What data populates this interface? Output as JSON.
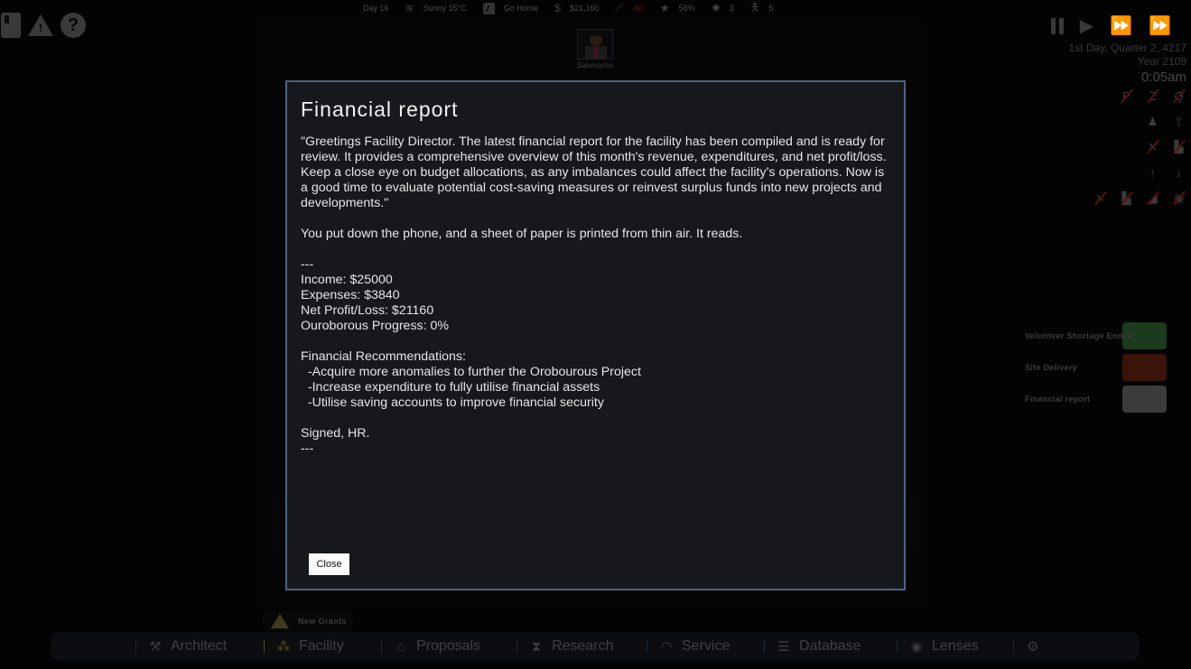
{
  "status_bar": {
    "day": "Day 16",
    "weather": "Sunny 15°C",
    "task": "Go Home",
    "money": "$21,160",
    "trend": "-$0",
    "reputation": "50%",
    "staff_count": "3",
    "personnel_count": "5",
    "icons": [
      "wind-icon",
      "task-icon",
      "dollar-icon",
      "trend-icon",
      "reputation-icon",
      "badge-icon",
      "person-icon"
    ]
  },
  "top_left": {
    "icons": [
      "phone-icon",
      "warning-icon",
      "help-icon"
    ]
  },
  "character": {
    "name": "Salamacha"
  },
  "time_controls": {
    "buttons": [
      "pause",
      "play",
      "fast-forward",
      "fastest-forward"
    ],
    "date_line": "1st Day, Quarter 2, 4217",
    "year_line": "Year 2109",
    "time": "0:05am"
  },
  "notifications": [
    {
      "label": "Volunteer Shortage Ended",
      "color": "#1c3a1e"
    },
    {
      "label": "Site Delivery",
      "color": "#3a1408"
    },
    {
      "label": "Financial report",
      "color": "#3a3b3d"
    }
  ],
  "modal": {
    "title": "Financial report",
    "intro": "\"Greetings Facility Director. The latest financial report for the facility has been compiled and is ready for review. It provides a comprehensive overview of this month's revenue, expenditures, and net profit/loss. Keep a close eye on budget allocations, as any imbalances could affect the facility’s operations. Now is a good time to evaluate potential cost-saving measures or reinvest surplus funds into new projects and developments.\"",
    "narration": "You put down the phone, and a sheet of paper is printed from thin air. It reads.",
    "divider": "---",
    "income": "Income: $25000",
    "expenses": "Expenses: $3840",
    "net": "Net Profit/Loss: $21160",
    "progress": "Ouroborous Progress: 0%",
    "recommendations_title": "Financial Recommendations:",
    "recommendations": [
      "  -Acquire more anomalies to further the Orobourous Project",
      "  -Increase expenditure to fully utilise financial assets",
      "  -Utilise saving accounts to improve financial security"
    ],
    "signature": "Signed, HR.",
    "close_label": "Close"
  },
  "alert": {
    "label": "New Grants"
  },
  "nav": {
    "items": [
      {
        "label": "Architect",
        "icon": "tools-icon"
      },
      {
        "label": "Facility",
        "icon": "people-icon",
        "active": true
      },
      {
        "label": "Proposals",
        "icon": "bank-icon"
      },
      {
        "label": "Research",
        "icon": "hourglass-icon"
      },
      {
        "label": "Service",
        "icon": "service-icon"
      },
      {
        "label": "Database",
        "icon": "database-icon"
      },
      {
        "label": "Lenses",
        "icon": "eye-icon"
      },
      {
        "label": "",
        "icon": "settings-icon"
      }
    ]
  }
}
